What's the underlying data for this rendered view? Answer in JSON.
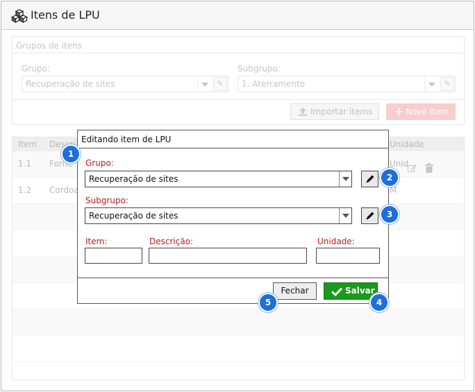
{
  "app": {
    "title": "Itens de LPU",
    "icon": "cubes-icon"
  },
  "groups_panel": {
    "title": "Grupos de itens",
    "grupo_label": "Grupo:",
    "grupo_value": "Recuperação de sites",
    "subgrupo_label": "Subgrupo:",
    "subgrupo_value": "1. Aterramento",
    "import_label": "Importar items",
    "new_label": "Novo Item"
  },
  "grid": {
    "columns": [
      "Item",
      "Descri",
      "Unidade"
    ],
    "rows": [
      {
        "item": "1.1",
        "descricao": "Forne",
        "unidade": "Unid"
      },
      {
        "item": "1.2",
        "descricao": "Cordoa",
        "unidade": "M"
      }
    ]
  },
  "modal": {
    "title": "Editando item de LPU",
    "grupo_label": "Grupo:",
    "grupo_value": "Recuperação de sites",
    "subgrupo_label": "Subgrupo:",
    "subgrupo_value": "Recuperação de sites",
    "item_label": "Item:",
    "item_value": "",
    "descricao_label": "Descrição:",
    "descricao_value": "",
    "unidade_label": "Unidade:",
    "unidade_value": "",
    "close_label": "Fechar",
    "save_label": "Salvar"
  },
  "badges": [
    "1",
    "2",
    "3",
    "4",
    "5"
  ],
  "colors": {
    "required": "#c21818",
    "save": "#1a9a1a",
    "badge": "#1e6fdc",
    "new_button": "#f08a8a"
  }
}
